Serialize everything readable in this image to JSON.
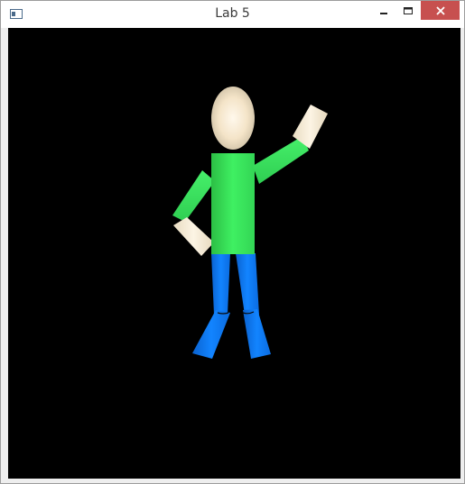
{
  "window": {
    "title": "Lab 5",
    "icons": {
      "app": "app-window-icon",
      "minimize": "minimize-icon",
      "maximize": "maximize-icon",
      "close": "close-icon"
    },
    "colors": {
      "title_bar": "#ffffff",
      "close_button": "#c7504f",
      "frame": "#eeeeee"
    }
  },
  "scene": {
    "background_color": "#000000",
    "figure": {
      "head_color": "#f4e4c8",
      "shirt_color": "#3ce65a",
      "pants_color": "#0b76f0",
      "skin_color": "#f6ecd6"
    }
  }
}
